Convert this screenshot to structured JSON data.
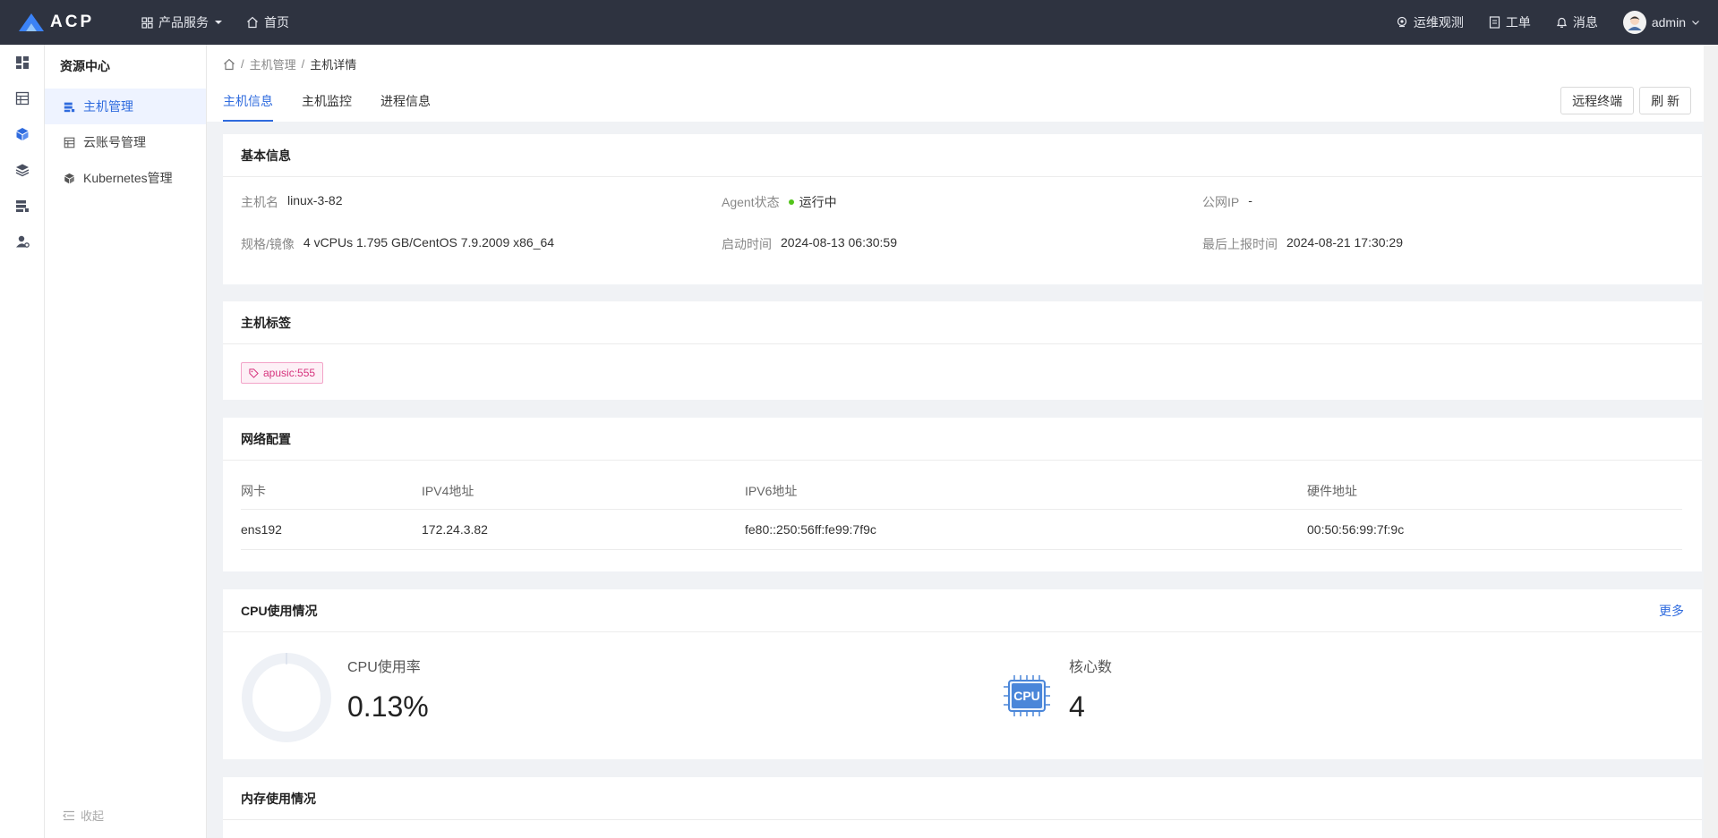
{
  "topbar": {
    "logo": "ACP",
    "nav": {
      "products": "产品服务",
      "home": "首页"
    },
    "right": {
      "ops": "运维观测",
      "ticket": "工单",
      "message": "消息",
      "user": "admin"
    }
  },
  "sidebar": {
    "title": "资源中心",
    "items": [
      {
        "label": "主机管理",
        "icon": "server-icon"
      },
      {
        "label": "云账号管理",
        "icon": "cloud-account-icon"
      },
      {
        "label": "Kubernetes管理",
        "icon": "cube-icon"
      }
    ],
    "collapse": "收起"
  },
  "breadcrumb": {
    "parent": "主机管理",
    "current": "主机详情"
  },
  "tabs": [
    "主机信息",
    "主机监控",
    "进程信息"
  ],
  "actions": {
    "terminal": "远程终端",
    "refresh": "刷 新"
  },
  "basic": {
    "title": "基本信息",
    "hostname_k": "主机名",
    "hostname_v": "linux-3-82",
    "agent_k": "Agent状态",
    "agent_v": "运行中",
    "publicip_k": "公网IP",
    "publicip_v": "-",
    "spec_k": "规格/镜像",
    "spec_v": "4 vCPUs 1.795 GB/CentOS 7.9.2009 x86_64",
    "boot_k": "启动时间",
    "boot_v": "2024-08-13 06:30:59",
    "report_k": "最后上报时间",
    "report_v": "2024-08-21 17:30:29"
  },
  "tags": {
    "title": "主机标签",
    "items": [
      "apusic:555"
    ]
  },
  "network": {
    "title": "网络配置",
    "columns": [
      "网卡",
      "IPV4地址",
      "IPV6地址",
      "硬件地址"
    ],
    "rows": [
      [
        "ens192",
        "172.24.3.82",
        "fe80::250:56ff:fe99:7f9c",
        "00:50:56:99:7f:9c"
      ]
    ]
  },
  "cpu": {
    "title": "CPU使用情况",
    "more": "更多",
    "usage_label": "CPU使用率",
    "usage_value": "0.13%",
    "usage_fraction": 0.0013,
    "cores_label": "核心数",
    "cores_value": "4",
    "chip_text": "CPU"
  },
  "memory": {
    "title": "内存使用情况"
  },
  "colors": {
    "accent": "#2f6bde",
    "topbar": "#2e3340",
    "running": "#52c41a",
    "tag": "#d6337d"
  }
}
